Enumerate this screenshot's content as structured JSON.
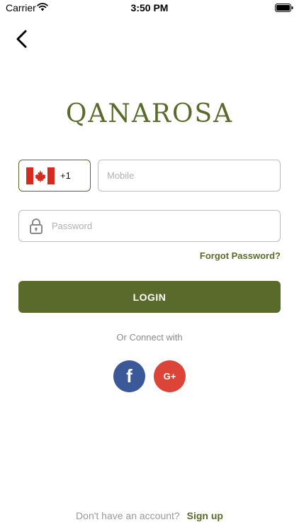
{
  "status_bar": {
    "carrier": "Carrier",
    "time": "3:50 PM",
    "icons": [
      "wifi-icon",
      "battery-icon"
    ]
  },
  "header": {
    "back_icon": "chevron-left-icon"
  },
  "brand": {
    "logo_text": "QANAROSA",
    "color": "#5a6a2a"
  },
  "form": {
    "country": {
      "flag_icon": "canada-flag-icon",
      "code": "+1"
    },
    "mobile": {
      "value": "",
      "placeholder": "Mobile"
    },
    "password": {
      "icon": "lock-icon",
      "value": "",
      "placeholder": "Password"
    },
    "forgot_label": "Forgot Password?",
    "login_label": "LOGIN"
  },
  "social": {
    "connect_text": "Or Connect with",
    "facebook_label": "f",
    "google_label": "G+",
    "colors": {
      "facebook": "#3b5998",
      "google": "#db4437"
    }
  },
  "footer": {
    "prompt": "Don't have an account?",
    "signup_label": "Sign up"
  },
  "colors": {
    "accent": "#5a6a2a",
    "border": "#bdbdbd",
    "muted_text": "#8a8a8a"
  }
}
